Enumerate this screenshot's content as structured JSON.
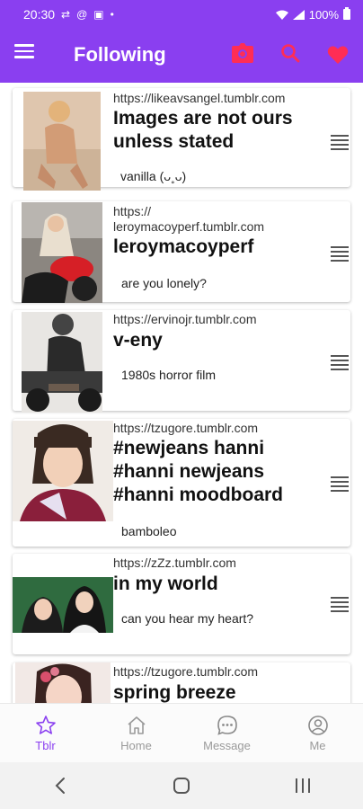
{
  "status_bar": {
    "time": "20:30",
    "icons": [
      "sync-icon",
      "at-icon",
      "app-icon",
      "dot-icon"
    ],
    "battery": "100%"
  },
  "app_bar": {
    "title": "Following",
    "actions": [
      "camera-icon",
      "search-icon",
      "heart-icon"
    ]
  },
  "colors": {
    "primary": "#8a3ff0",
    "accent": "#ff2d55"
  },
  "feed": {
    "items": [
      {
        "url": "https://likeavsangel.tumblr.com",
        "title_lines": [
          "Images are not ours",
          "unless stated"
        ],
        "description": "vanilla (ᴗ˳ᴗ)"
      },
      {
        "url_lines": [
          "https://",
          "leroymacoyperf.tumblr.com"
        ],
        "title_lines": [
          "leroymacoyperf"
        ],
        "description": "are you lonely?"
      },
      {
        "url": "https://ervinojr.tumblr.com",
        "title_lines": [
          "v-eny"
        ],
        "description": "1980s horror film"
      },
      {
        "url": "https://tzugore.tumblr.com",
        "title_lines": [
          "#newjeans hanni",
          "#hanni newjeans",
          "#hanni moodboard"
        ],
        "description": "bamboleo"
      },
      {
        "url": "https://zZz.tumblr.com",
        "title_lines": [
          "in my world"
        ],
        "description": "can you hear my heart?"
      },
      {
        "url": "https://tzugore.tumblr.com",
        "title_lines": [
          "spring breeze"
        ],
        "description": ""
      }
    ]
  },
  "bottom_nav": {
    "items": [
      {
        "label": "Tblr",
        "icon": "star-icon",
        "active": true
      },
      {
        "label": "Home",
        "icon": "home-icon",
        "active": false
      },
      {
        "label": "Message",
        "icon": "message-icon",
        "active": false
      },
      {
        "label": "Me",
        "icon": "profile-icon",
        "active": false
      }
    ]
  }
}
